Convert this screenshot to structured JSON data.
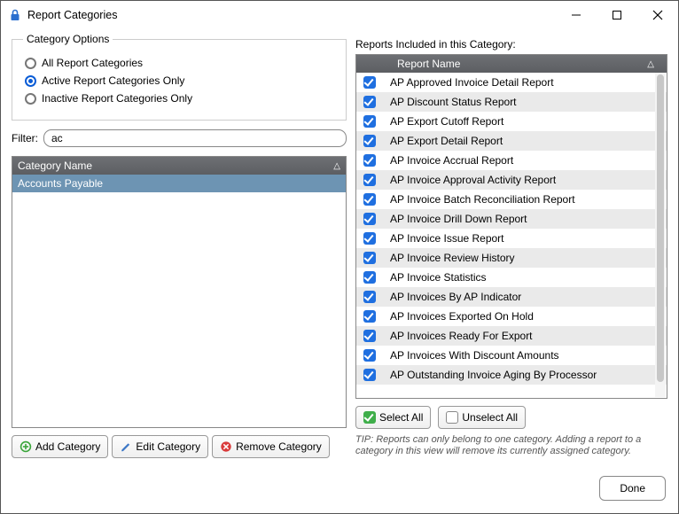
{
  "window": {
    "title": "Report Categories"
  },
  "category_options": {
    "legend": "Category Options",
    "radios": [
      {
        "label": "All Report Categories",
        "selected": false
      },
      {
        "label": "Active Report Categories Only",
        "selected": true
      },
      {
        "label": "Inactive Report Categories Only",
        "selected": false
      }
    ]
  },
  "filter": {
    "label": "Filter:",
    "value": "ac"
  },
  "category_grid": {
    "header": "Category Name",
    "rows": [
      {
        "name": "Accounts Payable",
        "selected": true
      }
    ]
  },
  "category_buttons": {
    "add": "Add Category",
    "edit": "Edit Category",
    "remove": "Remove Category"
  },
  "reports": {
    "section_label": "Reports Included in this Category:",
    "header": "Report Name",
    "rows": [
      {
        "name": "AP Approved Invoice Detail Report",
        "checked": true
      },
      {
        "name": "AP Discount Status Report",
        "checked": true
      },
      {
        "name": "AP Export Cutoff Report",
        "checked": true
      },
      {
        "name": "AP Export Detail Report",
        "checked": true
      },
      {
        "name": "AP Invoice Accrual Report",
        "checked": true
      },
      {
        "name": "AP Invoice Approval Activity Report",
        "checked": true
      },
      {
        "name": "AP Invoice Batch Reconciliation Report",
        "checked": true
      },
      {
        "name": "AP Invoice Drill Down Report",
        "checked": true
      },
      {
        "name": "AP Invoice Issue Report",
        "checked": true
      },
      {
        "name": "AP Invoice Review History",
        "checked": true
      },
      {
        "name": "AP Invoice Statistics",
        "checked": true
      },
      {
        "name": "AP Invoices By AP Indicator",
        "checked": true
      },
      {
        "name": "AP Invoices Exported On Hold",
        "checked": true
      },
      {
        "name": "AP Invoices Ready For Export",
        "checked": true
      },
      {
        "name": "AP Invoices With Discount Amounts",
        "checked": true
      },
      {
        "name": "AP Outstanding Invoice Aging By Processor",
        "checked": true
      }
    ],
    "select_all": "Select All",
    "unselect_all": "Unselect All",
    "tip": "TIP:  Reports can only belong to one category.  Adding a report to a category in this view will remove its currently assigned category."
  },
  "footer": {
    "done": "Done"
  }
}
